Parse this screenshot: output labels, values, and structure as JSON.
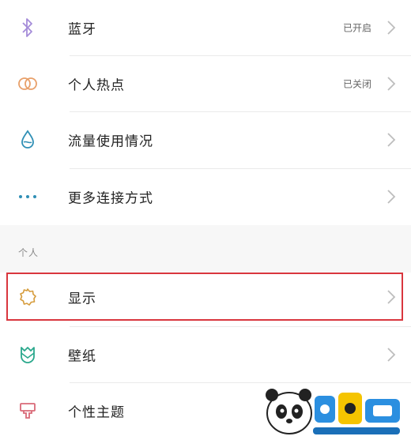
{
  "network": {
    "items": [
      {
        "id": "bluetooth",
        "label": "蓝牙",
        "status": "已开启",
        "icon": "bluetooth-icon",
        "icon_color": "#a58cd9"
      },
      {
        "id": "hotspot",
        "label": "个人热点",
        "status": "已关闭",
        "icon": "hotspot-icon",
        "icon_color": "#e8a06a"
      },
      {
        "id": "data-usage",
        "label": "流量使用情况",
        "status": "",
        "icon": "water-drop-icon",
        "icon_color": "#2f8fb5"
      },
      {
        "id": "more-connection",
        "label": "更多连接方式",
        "status": "",
        "icon": "dots-icon",
        "icon_color": "#2f8fb5"
      }
    ]
  },
  "personal": {
    "section_title": "个人",
    "items": [
      {
        "id": "display",
        "label": "显示",
        "icon": "sun-icon",
        "icon_color": "#d69c3c"
      },
      {
        "id": "wallpaper",
        "label": "壁纸",
        "icon": "tulip-icon",
        "icon_color": "#2aa88c"
      },
      {
        "id": "theme",
        "label": "个性主题",
        "icon": "brush-icon",
        "icon_color": "#d96a78"
      }
    ]
  },
  "highlight_color": "#d9363e",
  "watermark": {
    "url": "www.xiaohei.com"
  }
}
